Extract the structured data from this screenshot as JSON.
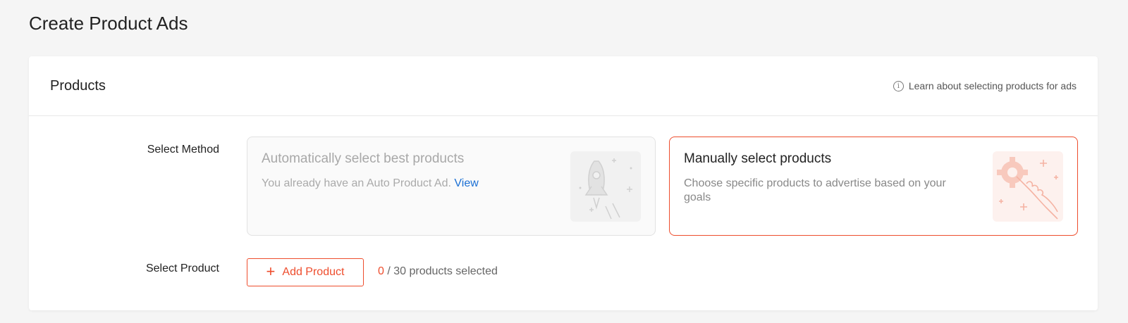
{
  "page": {
    "title": "Create Product Ads"
  },
  "products_card": {
    "title": "Products",
    "help_link": "Learn about selecting products for ads"
  },
  "select_method": {
    "label": "Select Method",
    "auto": {
      "title": "Automatically select best products",
      "desc": "You already have an Auto Product Ad.",
      "link": "View",
      "icon": "rocket-icon"
    },
    "manual": {
      "title": "Manually select products",
      "desc": "Choose specific products to advertise based on your goals",
      "icon": "gear-hand-icon"
    }
  },
  "select_product": {
    "label": "Select Product",
    "button": "Add Product",
    "selected_count": "0",
    "count_suffix": "/ 30 products selected"
  },
  "colors": {
    "accent": "#ee4d2d",
    "link": "#1a6fd4",
    "background": "#f5f5f5"
  }
}
